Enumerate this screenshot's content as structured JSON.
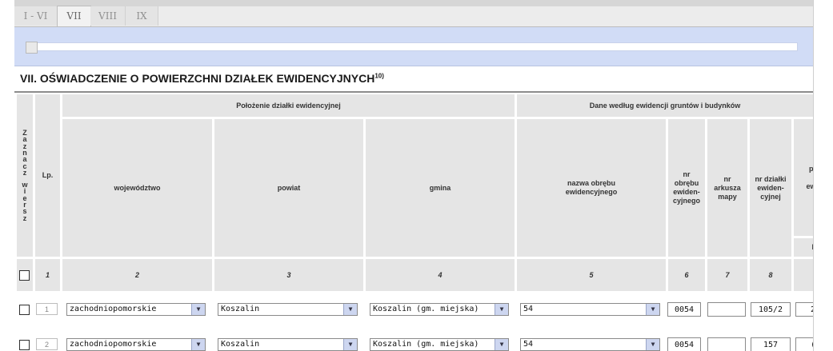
{
  "tabs": [
    {
      "label": "I - VI"
    },
    {
      "label": "VII"
    },
    {
      "label": "VIII"
    },
    {
      "label": "IX"
    }
  ],
  "active_tab": "VII",
  "section": {
    "title": "VII. OŚWIADCZENIE O POWIERZCHNI DZIAŁEK EWIDENCYJNYCH",
    "footnote": "10)"
  },
  "progress": {
    "value": 0
  },
  "table": {
    "select_col_letters": [
      "Z",
      "a",
      "z",
      "n",
      "a",
      "c",
      "z",
      "",
      "w",
      "i",
      "e",
      "r",
      "s",
      "z"
    ],
    "lp_header": "Lp.",
    "group_location": "Położenie działki ewidencyjnej",
    "group_registry": "Dane według ewidencji gruntów i budynków",
    "headers": {
      "wojewodztwo": "województwo",
      "powiat": "powiat",
      "gmina": "gmina",
      "nazwa_obrebu": "nazwa obrębu ewidencyjnego",
      "nr_obrebu": "nr obrębu ewiden-cyjnego",
      "nr_arkusza": "nr arkusza mapy",
      "nr_dzialki": "nr działki ewiden-cyjnej",
      "cut_col": [
        "po",
        "c",
        "ewi"
      ],
      "cut_sub": "h"
    },
    "column_numbers": [
      "1",
      "2",
      "3",
      "4",
      "5",
      "6",
      "7",
      "8"
    ],
    "rows": [
      {
        "lp": "1",
        "wojewodztwo": "zachodniopomorskie",
        "powiat": "Koszalin",
        "gmina": "Koszalin (gm. miejska)",
        "obreb": "54",
        "nr_obrebu": "0054",
        "nr_arkusza": "",
        "nr_dzialki": "105/2",
        "cut_value": "2"
      },
      {
        "lp": "2",
        "wojewodztwo": "zachodniopomorskie",
        "powiat": "Koszalin",
        "gmina": "Koszalin (gm. miejska)",
        "obreb": "54",
        "nr_obrebu": "0054",
        "nr_arkusza": "",
        "nr_dzialki": "157",
        "cut_value": "("
      }
    ]
  },
  "icons": {
    "dropdown": "chevron-down-icon",
    "checkbox": "checkbox-icon"
  },
  "colors": {
    "header_bg": "#e5e5e5",
    "panel_bg": "#d1dcf6",
    "select_arrow_bg": "#cdd6f0"
  }
}
